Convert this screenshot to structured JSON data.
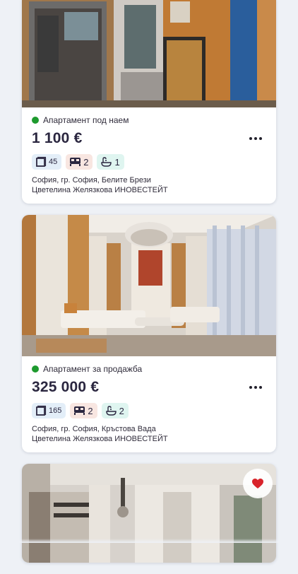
{
  "colors": {
    "status_green": "#1e9a2e",
    "favorite_red": "#d8232a"
  },
  "listings": [
    {
      "type": "Апартамент под наем",
      "price": "1 100 €",
      "area": "45",
      "bedrooms": "2",
      "bathrooms": "1",
      "location": "София, гр. София, Белите Брези",
      "agency": "Цветелина Желязкова ИНОВЕСТЕЙТ",
      "icons": [
        "area-icon",
        "bed-icon",
        "bath-icon",
        "more-options-icon"
      ]
    },
    {
      "type": "Апартамент за продажба",
      "price": "325 000 €",
      "area": "165",
      "bedrooms": "2",
      "bathrooms": "2",
      "location": "София, гр. София, Кръстова Вада",
      "agency": "Цветелина Желязкова ИНОВЕСТЕЙТ",
      "icons": [
        "area-icon",
        "bed-icon",
        "bath-icon",
        "more-options-icon"
      ]
    },
    {
      "favorite": true,
      "icons": [
        "heart-icon"
      ]
    }
  ]
}
